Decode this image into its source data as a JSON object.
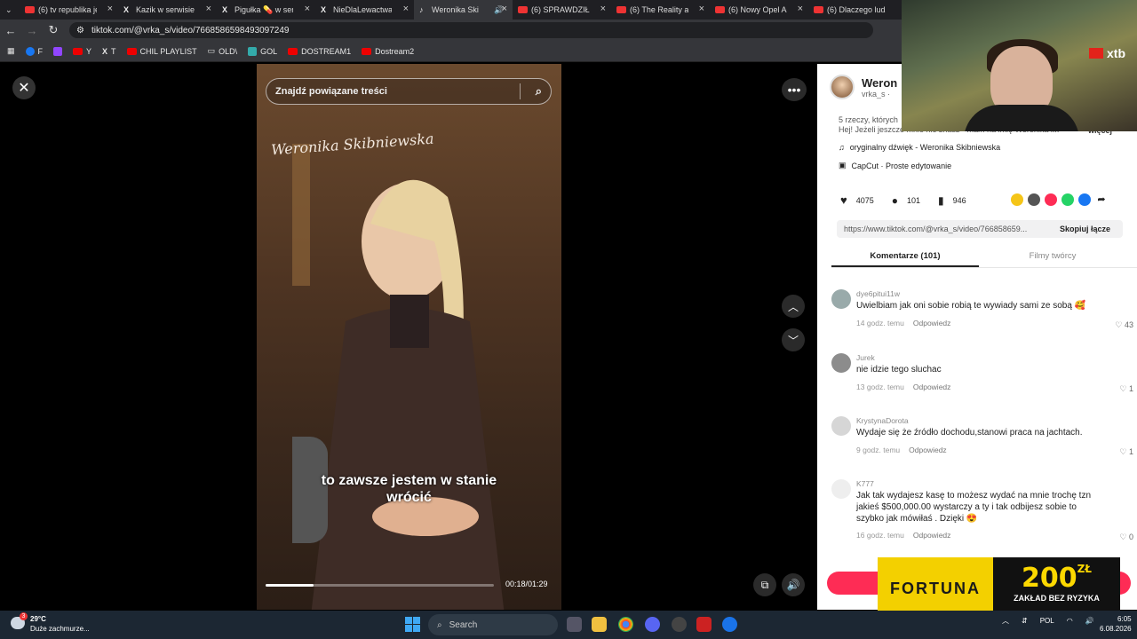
{
  "tabs": [
    {
      "title": "(6) tv republika je",
      "icon": "youtube-icon"
    },
    {
      "title": "Kazik w serwisie X",
      "icon": "x-icon"
    },
    {
      "title": "Pigułka 💊 w ser",
      "icon": "x-icon"
    },
    {
      "title": "NieDlaLewactwa",
      "icon": "x-icon"
    },
    {
      "title": "Weronika Ski",
      "icon": "tiktok-icon",
      "active": true
    },
    {
      "title": "(6) SPRAWDZIŁEM",
      "icon": "youtube-icon"
    },
    {
      "title": "(6) The Reality at",
      "icon": "youtube-icon"
    },
    {
      "title": "(6) Nowy Opel As",
      "icon": "youtube-icon"
    },
    {
      "title": "(6) Dlaczego ludz",
      "icon": "youtube-icon"
    }
  ],
  "address": {
    "url": "tiktok.com/@vrka_s/video/7668586598493097249"
  },
  "bookmarks": [
    "F",
    "",
    "Y",
    "T",
    "CHIL PLAYLIST",
    "OLD\\",
    "GOL",
    "DOSTREAM1",
    "Dostream2"
  ],
  "video": {
    "search_placeholder": "Znajdź powiązane treści",
    "signature": "Weronika Skibniewska",
    "subtitle_line1": "to zawsze jestem w stanie",
    "subtitle_line2": "wrócić",
    "time": "00:18/01:29",
    "progress": 0.21
  },
  "panel": {
    "author_name": "Weron",
    "author_handle": "vrka_s · ",
    "desc_line1": "5 rzeczy, których",
    "desc_line2": "Hej! Jeżeli jeszcze mnie nie znasz - mam na imię Weronika i...",
    "more": "więcej",
    "sound": "oryginalny dźwięk - Weronika Skibniewska",
    "capcut": "CapCut · Proste edytowanie",
    "likes": "4075",
    "comments": "101",
    "saves": "946",
    "link": "https://www.tiktok.com/@vrka_s/video/766858659...",
    "copy_label": "Skopiuj łącze",
    "tab_comments": "Komentarze (101)",
    "tab_creator": "Filmy twórcy"
  },
  "comments": [
    {
      "user": "dye6pitui11w",
      "text": "Uwielbiam jak oni sobie robią te wywiady sami ze sobą 🥰",
      "time": "14 godz. temu",
      "reply": "Odpowiedz",
      "likes": "43"
    },
    {
      "user": "Jurek",
      "text": "nie idzie tego sluchac",
      "time": "13 godz. temu",
      "reply": "Odpowiedz",
      "likes": "1"
    },
    {
      "user": "KrystynaDorota",
      "text": "Wydaje się że źródło dochodu,stanowi praca na jachtach.",
      "time": "9 godz. temu",
      "reply": "Odpowiedz",
      "likes": "1"
    },
    {
      "user": "K777",
      "text": "Jak tak wydajesz kasę to możesz wydać na mnie trochę tzn jakieś $500,000.00 wystarczy a ty i tak odbijesz sobie to szybko jak mówiłaś . Dzięki 😍",
      "time": "16 godz. temu",
      "reply": "Odpowiedz",
      "likes": "0"
    }
  ],
  "ad": {
    "brand": "FORTUNA",
    "amount": "200",
    "currency": "ZŁ",
    "tagline": "ZAKŁAD BEZ RYZYKA"
  },
  "overlay": {
    "logo": "xtb"
  },
  "taskbar": {
    "temp": "29°C",
    "weather": "Duże zachmurze...",
    "badge": "3",
    "search": "Search",
    "lang": "POL",
    "time": "6:05",
    "date": "6.08.2026"
  }
}
